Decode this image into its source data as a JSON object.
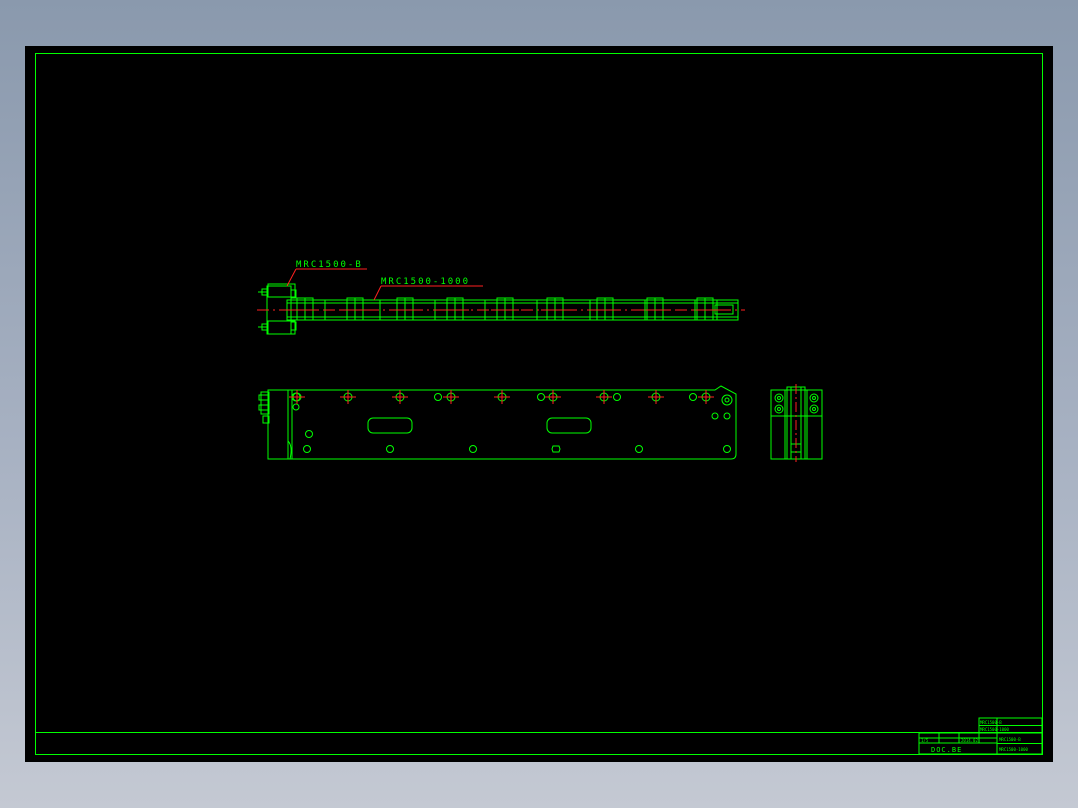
{
  "drawing": {
    "callouts": {
      "part_b": "MRC1500-B",
      "part_main": "MRC1500-1000"
    },
    "title_block": {
      "logo": "DOC.BE",
      "name": "MRC1500-B",
      "code": "MRC1500-1000",
      "scale": "1/5",
      "date": "2014.02"
    }
  },
  "colors": {
    "background": "#000000",
    "line": "#00ff00",
    "center": "#ff2020",
    "frame_outer": "#8a99ad"
  }
}
